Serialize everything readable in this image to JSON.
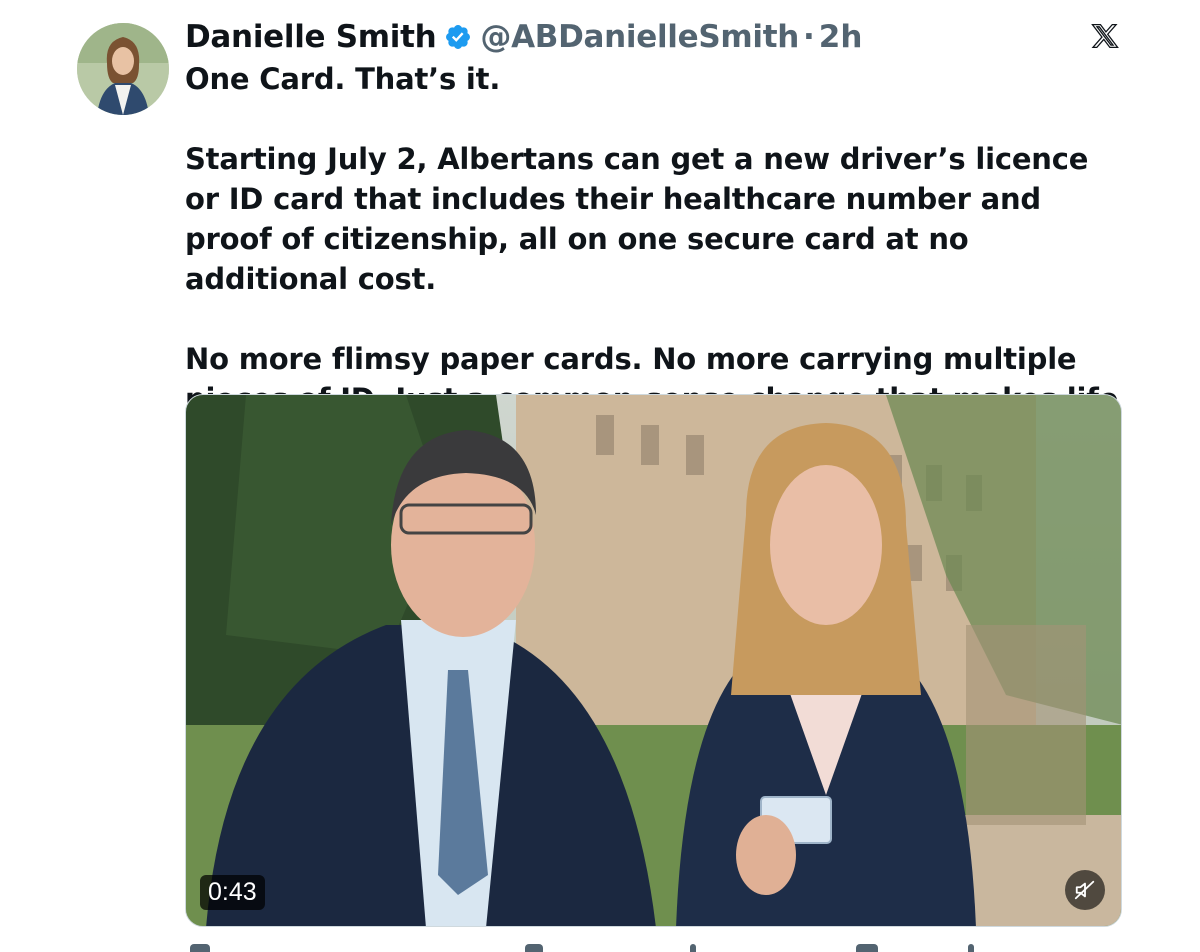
{
  "author": {
    "display_name": "Danielle Smith",
    "handle": "@ABDanielleSmith",
    "separator": "·",
    "time": "2h",
    "avatar_icon": "avatar-photo",
    "verified_icon": "verified-badge-icon",
    "verified_color": "#1d9bf0"
  },
  "platform": {
    "logo_icon": "x-logo-icon"
  },
  "tweet": {
    "line1": "One Card. That’s it.",
    "line2": "Starting July 2, Albertans can get a new driver’s licence or ID card that includes their healthcare number and proof of citizenship, all on one secure card at no additional cost.",
    "line3": "No more flimsy paper cards. No more carrying multiple pieces of ID. Just a common-sense change that makes life easier."
  },
  "media": {
    "type": "video",
    "duration": "0:43",
    "mute_icon": "muted-speaker-icon"
  },
  "colors": {
    "text_primary": "#0f1419",
    "text_secondary": "#536471",
    "accent": "#1d9bf0"
  }
}
